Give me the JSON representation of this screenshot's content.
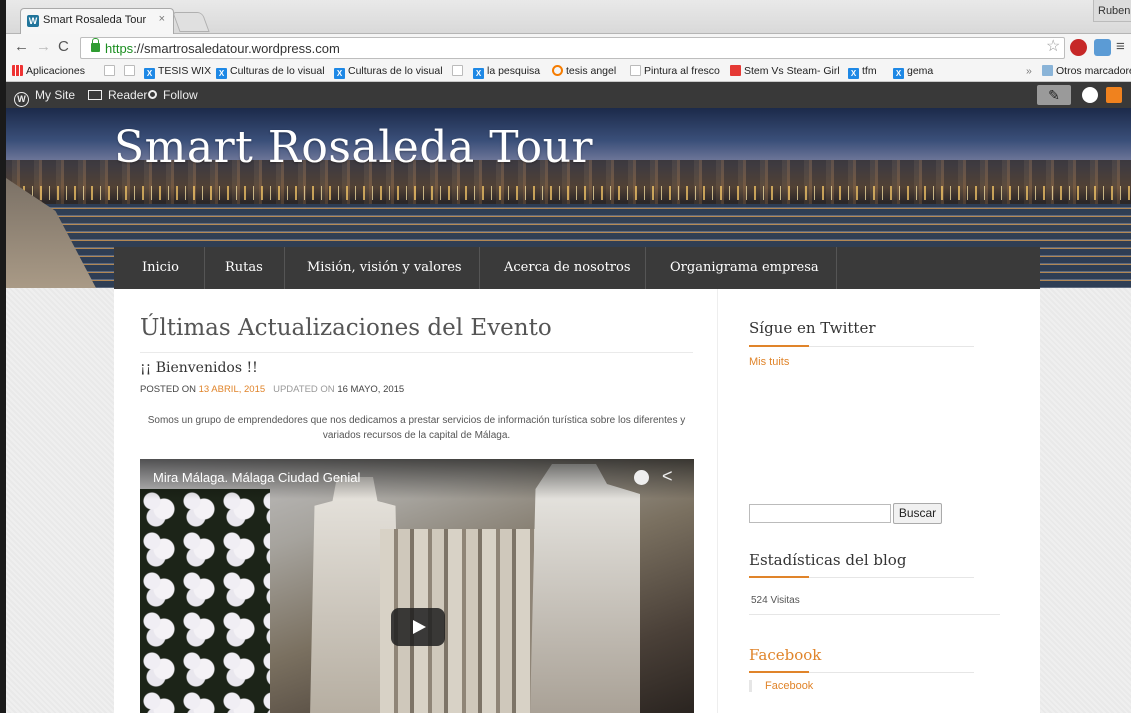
{
  "browser": {
    "tab_title": "Smart Rosaleda Tour",
    "tab_close": "×",
    "profile_name": "Ruben",
    "url_scheme": "https",
    "url_rest": "://smartrosaledatour.wordpress.com",
    "bookmarks": [
      {
        "label": "Aplicaciones",
        "icon": "apps-icon"
      },
      {
        "label": "",
        "icon": "page-icon"
      },
      {
        "label": "",
        "icon": "page-icon"
      },
      {
        "label": "TESIS WIX",
        "icon": "x-icon"
      },
      {
        "label": "Culturas de lo visual",
        "icon": "x-icon"
      },
      {
        "label": "Culturas de lo visual",
        "icon": "x-icon"
      },
      {
        "label": "",
        "icon": "page-icon"
      },
      {
        "label": "la pesquisa",
        "icon": "x-icon"
      },
      {
        "label": "tesis angel",
        "icon": "ring-icon"
      },
      {
        "label": "Pintura al fresco",
        "icon": "page-icon"
      },
      {
        "label": "Stem Vs Steam- Girl",
        "icon": "p-icon"
      },
      {
        "label": "tfm",
        "icon": "x-icon"
      },
      {
        "label": "gema",
        "icon": "x-icon"
      }
    ],
    "bookmarks_overflow": "»",
    "other_bookmarks": "Otros marcadores"
  },
  "adminbar": {
    "my_site": "My Site",
    "reader": "Reader",
    "follow": "Follow"
  },
  "site": {
    "title": "Smart Rosaleda Tour",
    "nav": [
      "Inicio",
      "Rutas",
      "Misión, visión y valores",
      "Acerca de nosotros",
      "Organigrama empresa"
    ]
  },
  "main": {
    "heading": "Últimas Actualizaciones del Evento",
    "post_title": "¡¡ Bienvenidos !!",
    "posted_on_label": "POSTED ON",
    "posted_on_date": "13 ABRIL, 2015",
    "updated_on_label": "UPDATED ON",
    "updated_on_date": "16 MAYO, 2015",
    "text": "Somos un grupo de emprendedores que nos dedicamos a prestar servicios de información turística sobre los diferentes y variados recursos de la capital de Málaga.",
    "video_title": "Mira Málaga. Málaga Ciudad Genial"
  },
  "sidebar": {
    "twitter_title": "Sígue en Twitter",
    "twitter_link": "Mis tuits",
    "search_button": "Buscar",
    "stats_title": "Estadísticas del blog",
    "stats_text": "524 Visitas",
    "facebook_title": "Facebook",
    "facebook_link": "Facebook"
  },
  "colors": {
    "accent": "#e0842a",
    "nav_bg": "#3a3a3a",
    "adminbar_bg": "#393939"
  }
}
